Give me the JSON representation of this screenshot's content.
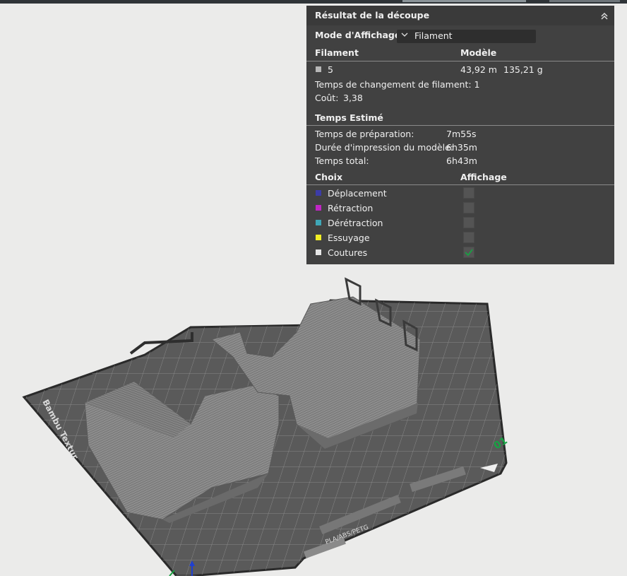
{
  "panel": {
    "title": "Résultat de la découpe",
    "display_mode_label": "Mode d'Affichage",
    "display_mode_value": "Filament",
    "filament_header": "Filament",
    "model_header": "Modèle",
    "filament_row": {
      "id": "5",
      "length": "43,92 m",
      "weight": "135,21 g",
      "color": "#b7b7b7"
    },
    "filament_change_time": "Temps de changement de filament:  1",
    "cost_label": "Coût:",
    "cost_value": "3,38",
    "estimated_time_header": "Temps Estimé",
    "times": [
      {
        "label": "Temps de préparation:",
        "value": "7m55s"
      },
      {
        "label": "Durée d'impression du modèle:",
        "value": "6h35m"
      },
      {
        "label": "Temps total:",
        "value": "6h43m"
      }
    ],
    "choice_header": "Choix",
    "display_header": "Affichage",
    "choices": [
      {
        "label": "Déplacement",
        "color": "#3c3ca8",
        "checked": false
      },
      {
        "label": "Rétraction",
        "color": "#c026c4",
        "checked": false
      },
      {
        "label": "Dérétraction",
        "color": "#3fa7b7",
        "checked": false
      },
      {
        "label": "Essuyage",
        "color": "#f2ee25",
        "checked": false
      },
      {
        "label": "Coutures",
        "color": "#e6e6e6",
        "checked": true
      }
    ]
  },
  "plate": {
    "number": "01",
    "brand_text": "Bambu Textur",
    "filament_text": "PLA/ABS/PETG",
    "number_color": "#17a243"
  }
}
